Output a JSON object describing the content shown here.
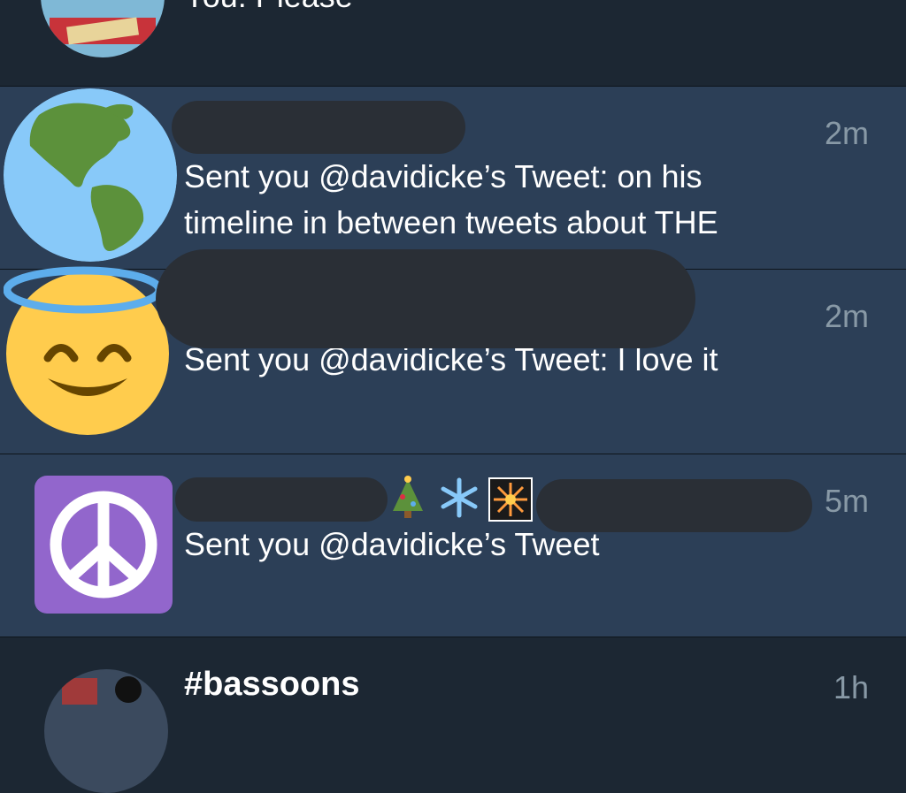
{
  "conversations": [
    {
      "preview": "You: Please",
      "avatar": "decorated-portrait-avatar"
    },
    {
      "preview_line1": "Sent you @davidicke’s Tweet: on his",
      "preview_line2": "timeline in between tweets about THE",
      "time": "2m",
      "avatar": "globe-americas-icon"
    },
    {
      "preview": "Sent you @davidicke’s Tweet: I love it",
      "time": "2m",
      "avatar": "smiling-face-with-halo-icon"
    },
    {
      "preview": "Sent you @davidicke’s Tweet",
      "time": "5m",
      "avatar": "peace-symbol-icon",
      "name_emojis": [
        "christmas-tree-icon",
        "snowflake-icon",
        "fireworks-icon"
      ]
    },
    {
      "title": "#bassoons",
      "time": "1h",
      "avatar": "group-photo-avatar"
    }
  ],
  "colors": {
    "background": "#1c2733",
    "unread_row": "#2c3f57",
    "text": "#ffffff",
    "muted": "#8899a6",
    "redaction": "#2a2f36"
  }
}
